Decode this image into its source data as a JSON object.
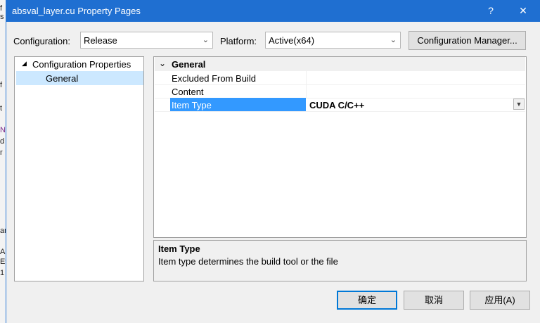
{
  "window": {
    "title": "absval_layer.cu Property Pages",
    "help_label": "?",
    "close_label": "✕"
  },
  "background_fragments": [
    "f",
    "s",
    "f",
    "t",
    "N",
    "d",
    "r",
    "e",
    "A",
    "Ef",
    "1",
    "ar"
  ],
  "config": {
    "configuration_label": "Configuration:",
    "configuration_value": "Release",
    "platform_label": "Platform:",
    "platform_value": "Active(x64)",
    "manager_button": "Configuration Manager..."
  },
  "tree": {
    "root": "Configuration Properties",
    "child": "General"
  },
  "grid": {
    "category": "General",
    "rows": [
      {
        "name": "Excluded From Build",
        "value": ""
      },
      {
        "name": "Content",
        "value": ""
      },
      {
        "name": "Item Type",
        "value": "CUDA C/C++"
      }
    ]
  },
  "description": {
    "title": "Item Type",
    "text": "Item type determines the build tool or the file"
  },
  "buttons": {
    "ok": "确定",
    "cancel": "取消",
    "apply": "应用(A)"
  }
}
